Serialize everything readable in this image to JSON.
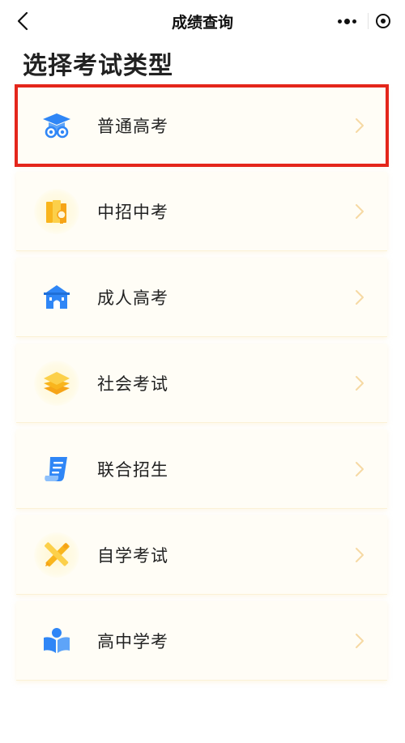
{
  "navbar": {
    "title": "成绩查询",
    "back_icon": "chevron-left-icon",
    "more_icon": "more-dots-icon",
    "close_icon": "target-circle-icon"
  },
  "heading": "选择考试类型",
  "colors": {
    "accent_blue": "#2f86f6",
    "accent_yellow": "#f9c02e",
    "highlight_red": "#e4261b",
    "chevron": "#f6d9a3"
  },
  "exam_types": [
    {
      "label": "普通高考",
      "icon": "graduation-cap-icon",
      "highlighted": true
    },
    {
      "label": "中招中考",
      "icon": "books-icon",
      "highlighted": false
    },
    {
      "label": "成人高考",
      "icon": "building-icon",
      "highlighted": false
    },
    {
      "label": "社会考试",
      "icon": "layers-icon",
      "highlighted": false
    },
    {
      "label": "联合招生",
      "icon": "document-icon",
      "highlighted": false
    },
    {
      "label": "自学考试",
      "icon": "pencil-ruler-icon",
      "highlighted": false
    },
    {
      "label": "高中学考",
      "icon": "open-book-icon",
      "highlighted": false
    }
  ]
}
